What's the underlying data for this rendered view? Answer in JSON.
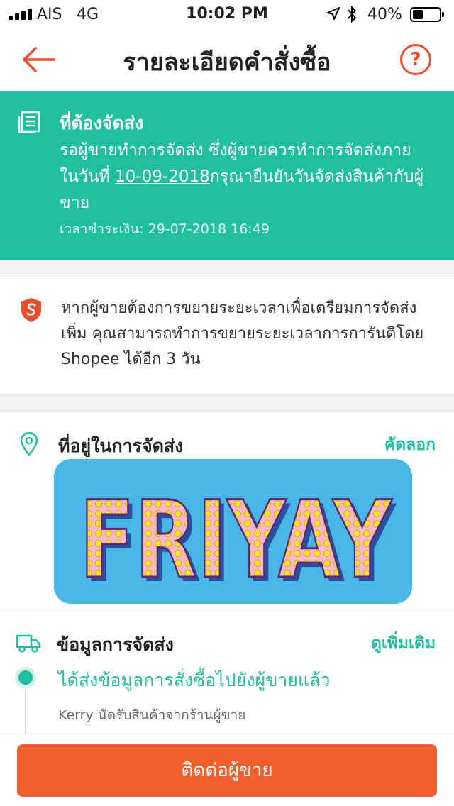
{
  "status_bar": {
    "carrier": "AIS",
    "network": "4G",
    "time": "10:02 PM",
    "battery": "40%",
    "battery_level": 0.4
  },
  "header": {
    "title": "รายละเอียดคำสั่งซื้อ",
    "back_icon": "arrow-left-icon",
    "help_label": "?"
  },
  "banner": {
    "title": "ที่ต้องจัดส่ง",
    "text_before": "รอผู้ขายทำการจัดส่ง ซึ่งผู้ขายควรทำการจัดส่งภาย ในวันที่ ",
    "date": "10-09-2018",
    "text_after": "กรุณายืนยันวันจัดส่งสินค้ากับผู้ขาย",
    "payment_time": "เวลาชำระเงิน: 29-07-2018 16:49",
    "color": "#1fbfa0"
  },
  "guarantee": {
    "text": "หากผู้ขายต้องการขยายระยะเวลาเพื่อเตรียมการจัดส่งเพิ่ม คุณสามารถทำการขยายระยะเวลาการการันตีโดย Shopee ได้อีก 3 วัน"
  },
  "address": {
    "title": "ที่อยู่ในการจัดส่ง",
    "copy_label": "คัดลอก",
    "sticker_text": "FRIYAY"
  },
  "shipping": {
    "title": "ข้อมูลการจัดส่ง",
    "more_label": "ดูเพิ่มเติม",
    "status": "ได้ส่งข้อมูลการสั่งซื้อไปยังผู้ขายแล้ว",
    "detail": "Kerry นัดรับสินค้าจากร้านผู้ขาย"
  },
  "bottom": {
    "contact_label": "ติดต่อผู้ขาย",
    "accent": "#f05f2e"
  }
}
